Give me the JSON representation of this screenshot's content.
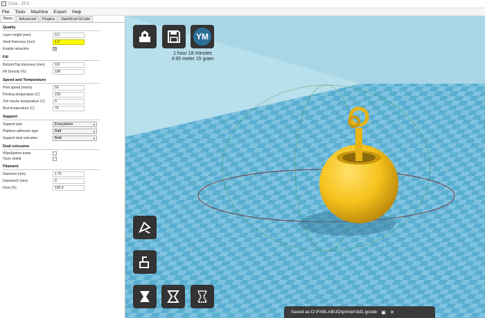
{
  "window": {
    "title": "Cura - 15.0"
  },
  "menu": [
    "File",
    "Tools",
    "Machine",
    "Expert",
    "Help"
  ],
  "tabs": [
    "Basic",
    "Advanced",
    "Plugins",
    "Start/End-GCode"
  ],
  "sections": {
    "quality": {
      "title": "Quality",
      "layer_height": {
        "label": "Layer height (mm)",
        "value": "0.2"
      },
      "shell_thickness": {
        "label": "Shell thickness (mm)",
        "value": "1.2"
      },
      "enable_retraction": {
        "label": "Enable retraction",
        "value": "☑"
      }
    },
    "fill": {
      "title": "Fill",
      "bottom_top": {
        "label": "Bottom/Top thickness (mm)",
        "value": "0.8"
      },
      "fill_density": {
        "label": "Fill Density (%)",
        "value": "100"
      }
    },
    "speed": {
      "title": "Speed and Temperature",
      "print_speed": {
        "label": "Print speed (mm/s)",
        "value": "50"
      },
      "printing_temp": {
        "label": "Printing temperature (C)",
        "value": "210"
      },
      "second_nozzle": {
        "label": "2nd nozzle temperature (C)",
        "value": "0"
      },
      "bed_temp": {
        "label": "Bed temperature (C)",
        "value": "70"
      }
    },
    "support": {
      "title": "Support",
      "support_type": {
        "label": "Support type",
        "value": "Everywhere"
      },
      "platform_adhesion": {
        "label": "Platform adhesion type",
        "value": "Raft"
      },
      "support_dual": {
        "label": "Support dual extrusion",
        "value": "Both"
      }
    },
    "dual": {
      "title": "Dual extrusion",
      "wipe_tower": {
        "label": "Wipe&prime tower"
      },
      "ooze_shield": {
        "label": "Ooze shield"
      }
    },
    "filament": {
      "title": "Filament",
      "diameter": {
        "label": "Diameter (mm)",
        "value": "1.75"
      },
      "diameter2": {
        "label": "Diameter2 (mm)",
        "value": "0"
      },
      "flow": {
        "label": "Flow (%)",
        "value": "100.0"
      }
    }
  },
  "viewport": {
    "print_time": "1 hour 18 minutes",
    "print_material": "4.95 meter 15 gram",
    "ym_label": "YM",
    "save_message": "Saved as D:\\FABLAB\\3D\\printer\\3d1.gcode",
    "save_folder_icon": "folder-icon",
    "save_close_icon": "close-icon"
  },
  "colors": {
    "grid_dark": "#5aaed1",
    "grid_light": "#7ec3df",
    "background": "#a9d6e6",
    "model": "#f6c21c",
    "toolbar": "#333333",
    "highlight": "#ffff00"
  }
}
